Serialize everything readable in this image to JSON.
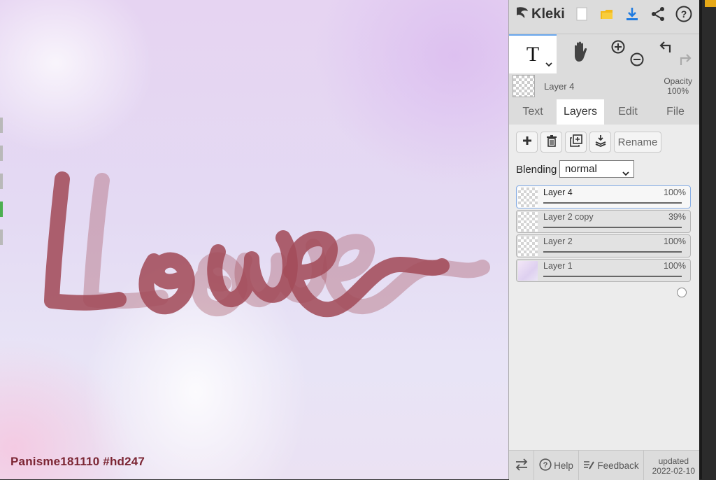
{
  "app": {
    "logo_text": "Kleki"
  },
  "canvas": {
    "watermark": "Panisme181110 #hd247"
  },
  "tools": {
    "text_glyph": "T"
  },
  "current_layer": {
    "name": "Layer 4",
    "opacity_label": "Opacity",
    "opacity_value": "100%"
  },
  "tabs": [
    {
      "label": "Text",
      "active": false
    },
    {
      "label": "Layers",
      "active": true
    },
    {
      "label": "Edit",
      "active": false
    },
    {
      "label": "File",
      "active": false
    }
  ],
  "layer_actions": {
    "rename_label": "Rename"
  },
  "blending": {
    "label": "Blending",
    "value": "normal"
  },
  "layers": [
    {
      "name": "Layer 4",
      "opacity": "100%",
      "level": 1.0,
      "active": true
    },
    {
      "name": "Layer 2 copy",
      "opacity": "39%",
      "level": 0.39,
      "active": false
    },
    {
      "name": "Layer 2",
      "opacity": "100%",
      "level": 1.0,
      "active": false
    },
    {
      "name": "Layer 1",
      "opacity": "100%",
      "level": 1.0,
      "active": false
    }
  ],
  "footer": {
    "help_label": "Help",
    "feedback_label": "Feedback",
    "updated_label": "updated",
    "updated_date": "2022-02-10"
  },
  "colors": {
    "stroke": "#a34c5a",
    "accent": "#6aa8ee",
    "download": "#1e7ae0",
    "folder": "#f3b91a"
  },
  "icons": [
    "kleki-logo-icon",
    "new-file-icon",
    "open-folder-icon",
    "download-icon",
    "share-icon",
    "help-circle-icon",
    "hand-icon",
    "zoom-in-icon",
    "zoom-out-icon",
    "undo-icon",
    "redo-icon",
    "add-layer-icon",
    "trash-icon",
    "duplicate-layer-icon",
    "merge-down-icon",
    "swap-icon",
    "feedback-icon"
  ]
}
